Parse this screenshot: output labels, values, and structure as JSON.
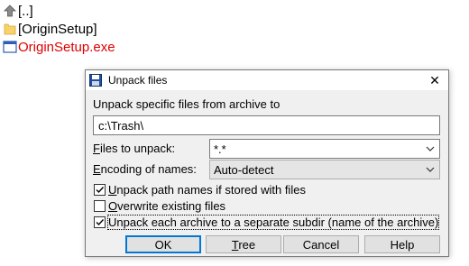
{
  "file_list": [
    {
      "icon": "up-arrow-icon",
      "label": "[..]"
    },
    {
      "icon": "folder-icon",
      "label": "[OriginSetup]"
    },
    {
      "icon": "exe-file-icon",
      "label": "OriginSetup.exe"
    }
  ],
  "dialog": {
    "title": "Unpack files",
    "close_glyph": "✕",
    "unpack_to_label": "Unpack specific files from archive to",
    "target_path": "c:\\Trash\\",
    "files_to_unpack": {
      "label_key": "F",
      "label_rest": "iles to unpack:",
      "value": "*.*"
    },
    "encoding": {
      "label_key": "E",
      "label_rest": "ncoding of names:",
      "value": "Auto-detect"
    },
    "checkboxes": [
      {
        "key": "U",
        "rest": "npack path names if stored with files",
        "checked": true
      },
      {
        "key": "O",
        "rest": "verwrite existing files",
        "checked": false
      },
      {
        "key": "",
        "rest": "Unpack each archive to a separate subdir (name of the archive)",
        "checked": true
      }
    ],
    "buttons": {
      "ok": "OK",
      "tree_key": "T",
      "tree_rest": "ree",
      "cancel": "Cancel",
      "help": "Help"
    }
  },
  "colors": {
    "exe_text": "#e00000",
    "default_button_border": "#0078d7",
    "folder": "#f8d26a"
  }
}
